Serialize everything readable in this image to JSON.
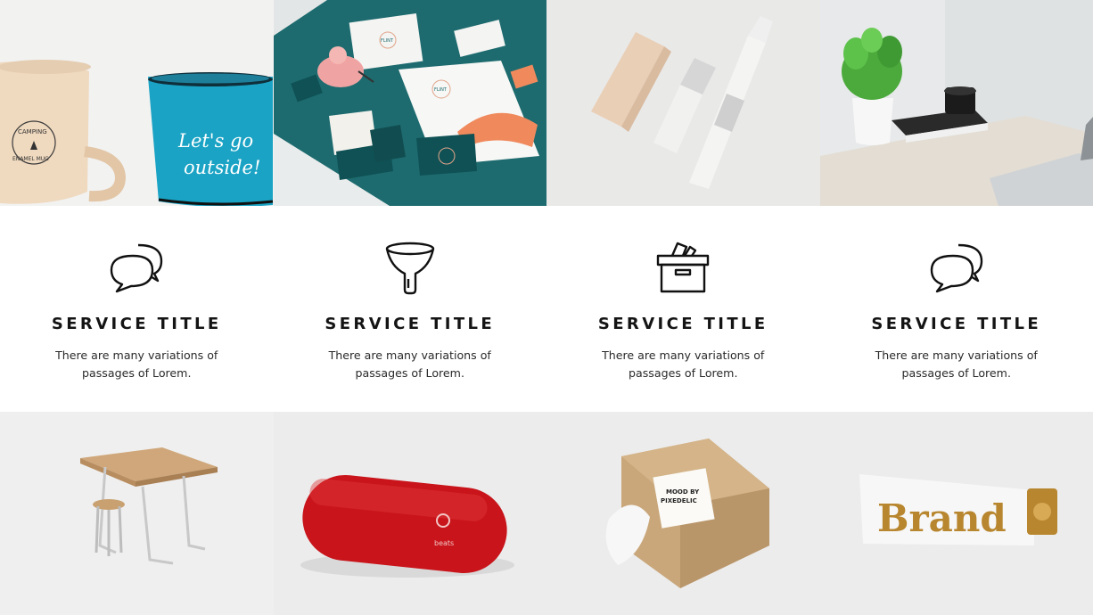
{
  "gallery_top": [
    {
      "name": "camping-mugs-photo",
      "mug_text_1": "CAMPING",
      "mug_text_2": "ENAMEL MUG",
      "mug_text_3": "Let's go",
      "mug_text_4": "outside!"
    },
    {
      "name": "stationery-branding-photo",
      "brand_word": "FLINT"
    },
    {
      "name": "cosmetic-bottles-photo"
    },
    {
      "name": "desk-plant-laptop-photo"
    }
  ],
  "services": [
    {
      "icon": "chat-bubbles-icon",
      "title": "SERVICE TITLE",
      "text_line1": "There are many variations of",
      "text_line2": "passages of Lorem."
    },
    {
      "icon": "funnel-icon",
      "title": "SERVICE TITLE",
      "text_line1": "There are many variations of",
      "text_line2": "passages of Lorem."
    },
    {
      "icon": "archive-box-icon",
      "title": "SERVICE TITLE",
      "text_line1": "There are many variations of",
      "text_line2": "passages of Lorem."
    },
    {
      "icon": "chat-bubbles-icon",
      "title": "SERVICE TITLE",
      "text_line1": "There are many variations of",
      "text_line2": "passages of Lorem."
    }
  ],
  "gallery_bottom": [
    {
      "name": "table-stool-photo"
    },
    {
      "name": "red-speaker-photo",
      "logo_text": "beats"
    },
    {
      "name": "kraft-box-photo",
      "label_line1": "MOOD BY",
      "label_line2": "PIXEDELIC"
    },
    {
      "name": "brand-tube-photo",
      "brand_text": "Brand"
    }
  ],
  "colors": {
    "teal": "#1d6b6f",
    "mug_blue": "#1aa3c4",
    "beige": "#efd9bf",
    "red": "#c8141a",
    "gold": "#b8862e",
    "text": "#141414"
  }
}
